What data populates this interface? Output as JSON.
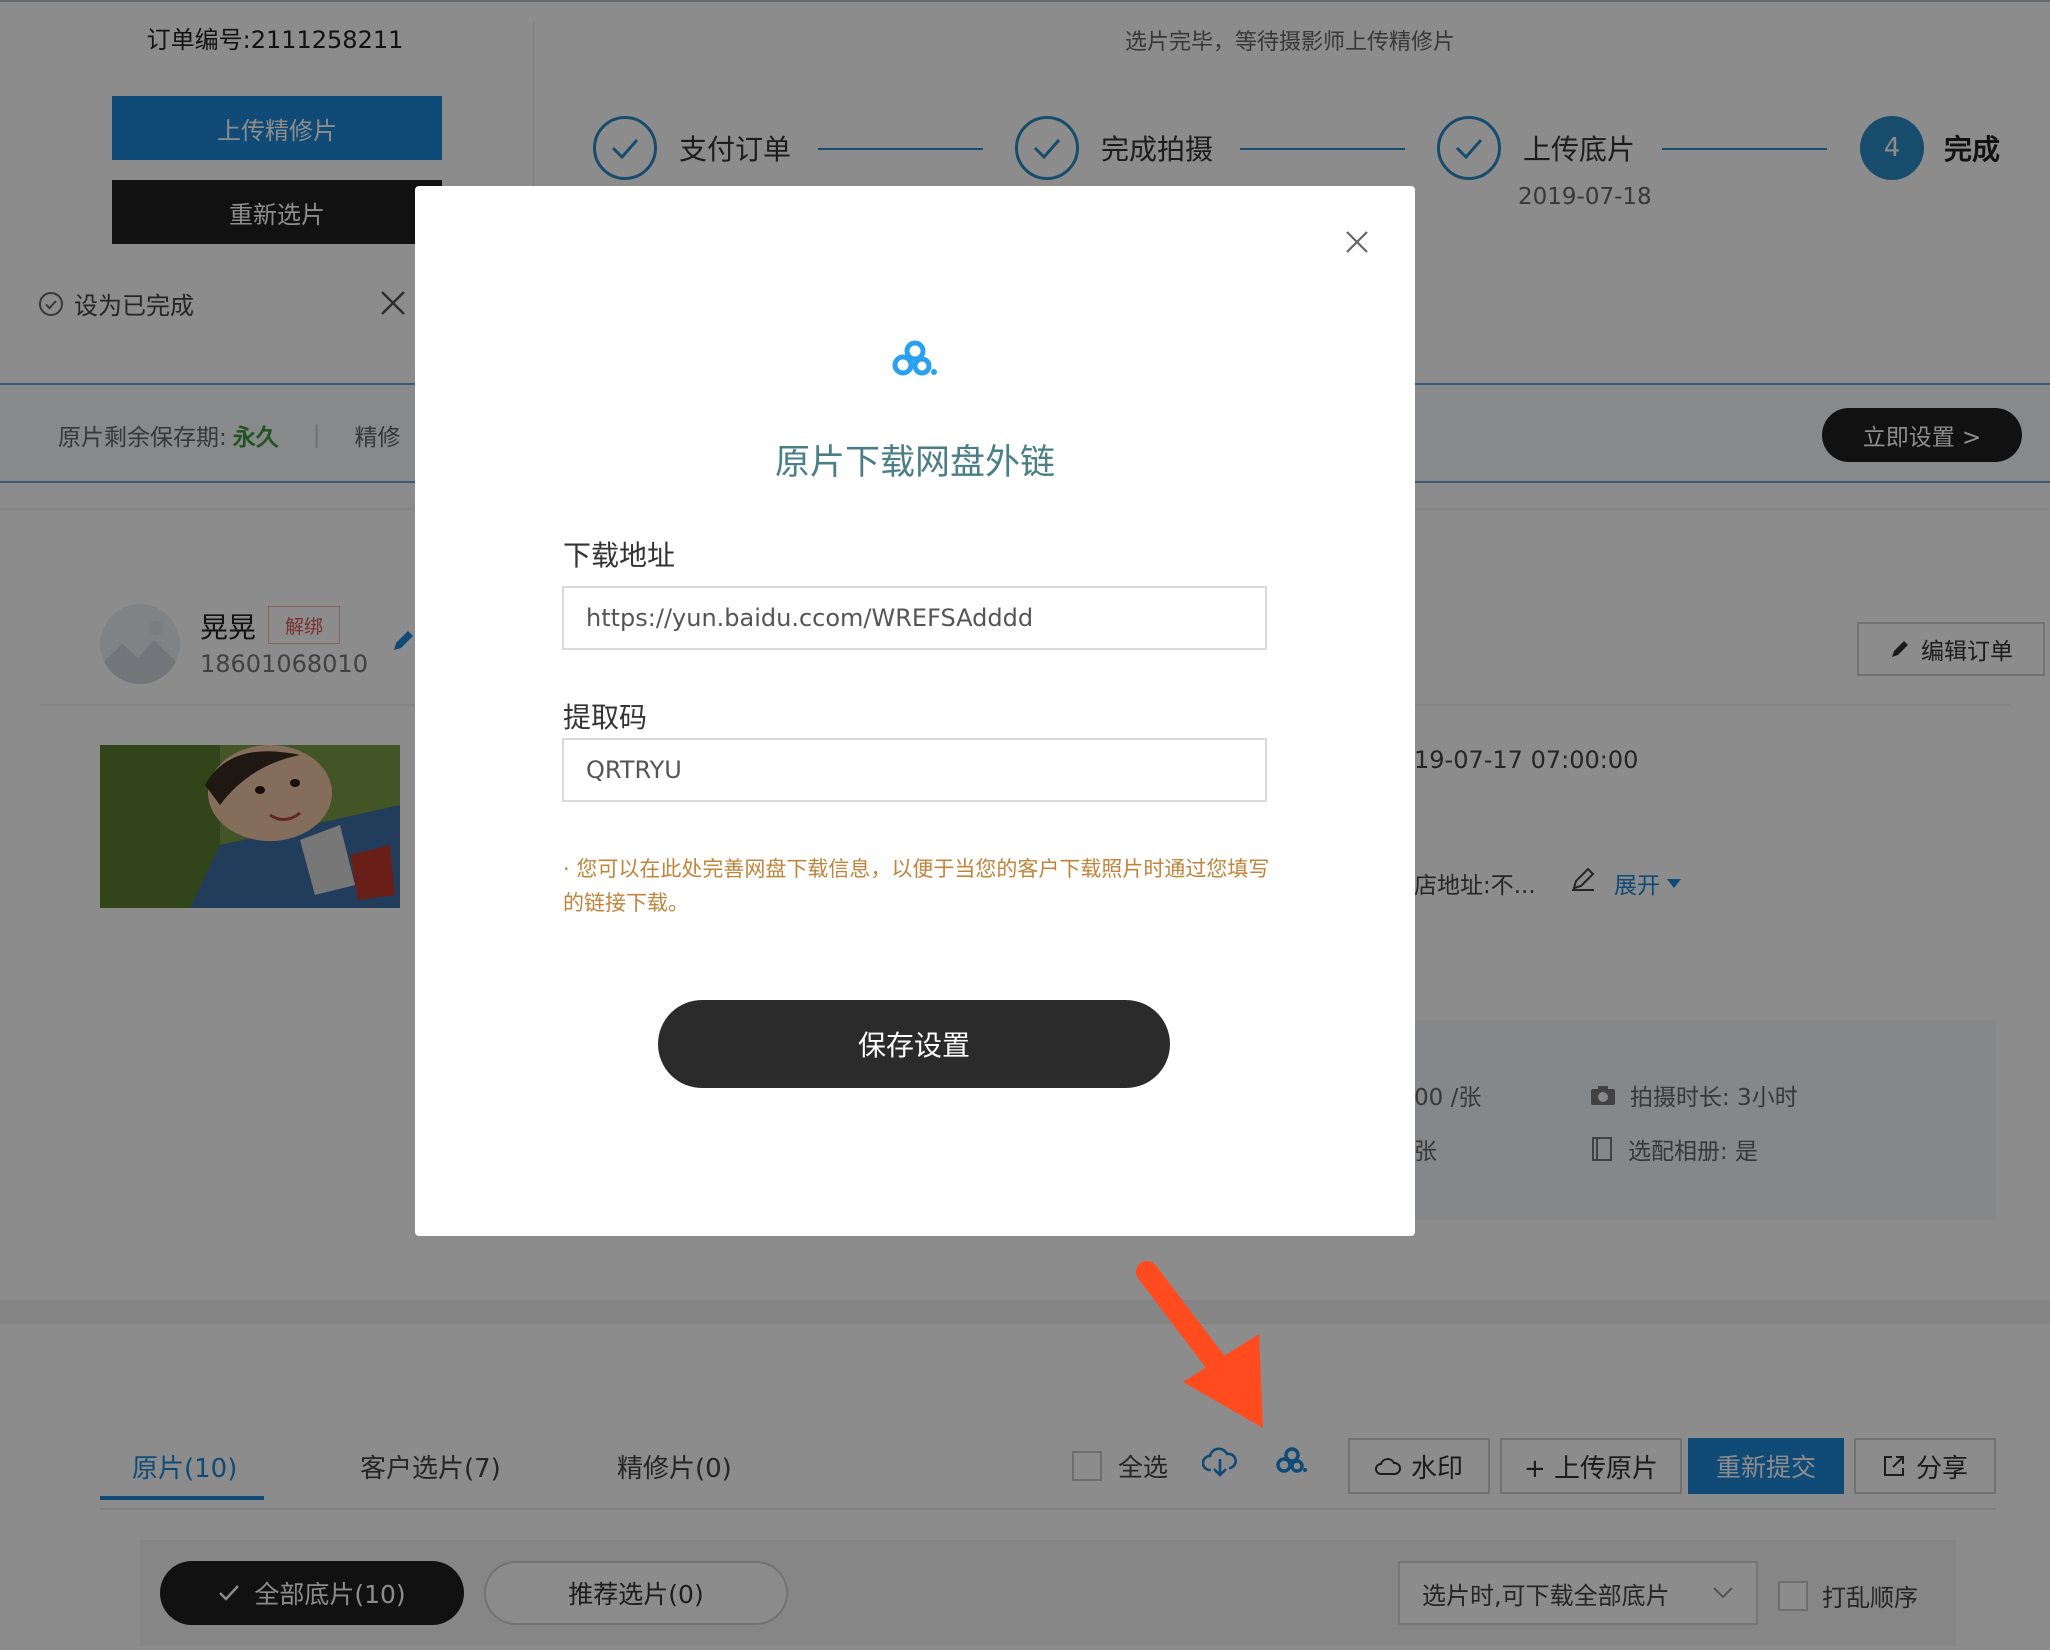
{
  "order": {
    "number_label": "订单编号:2111258211",
    "upload_refined_label": "上传精修片",
    "reselect_label": "重新选片",
    "mark_done_label": "设为已完成"
  },
  "progress": {
    "status_text": "选片完毕，等待摄影师上传精修片",
    "steps": [
      {
        "label": "支付订单",
        "date": "",
        "state": "done"
      },
      {
        "label": "完成拍摄",
        "date": "",
        "state": "done"
      },
      {
        "label": "上传底片",
        "date": "2019-07-18",
        "state": "done"
      },
      {
        "label": "完成",
        "number": "4",
        "state": "current"
      }
    ]
  },
  "notice": {
    "retention_label": "原片剩余保存期:",
    "retention_value": "永久",
    "separator": "|",
    "truncated_text": "精修",
    "set_now_label": "立即设置 >"
  },
  "customer": {
    "name": "晃晃",
    "unbind_label": "解绑",
    "phone": "18601068010",
    "edit_order_label": "编辑订单"
  },
  "order_detail": {
    "datetime_partial": "19-07-17 07:00:00",
    "address_partial": "店地址:不...",
    "expand_label": "展开",
    "price_partial": "00 /张",
    "count_partial": "张",
    "duration_label": "拍摄时长: 3小时",
    "album_label": "选配相册: 是"
  },
  "tabs": [
    {
      "label": "原片(10)",
      "active": true
    },
    {
      "label": "客户选片(7)",
      "active": false
    },
    {
      "label": "精修片(0)",
      "active": false
    }
  ],
  "toolbar": {
    "select_all_label": "全选",
    "watermark_label": "水印",
    "upload_original_label": "+ 上传原片",
    "resubmit_label": "重新提交",
    "share_label": "分享"
  },
  "filter": {
    "all_negatives_label": "全部底片(10)",
    "recommended_label": "推荐选片(0)",
    "download_option": "选片时,可下载全部底片",
    "shuffle_label": "打乱顺序"
  },
  "modal": {
    "title": "原片下载网盘外链",
    "download_url_label": "下载地址",
    "download_url_value": "https://yun.baidu.ccom/WREFSAdddd",
    "code_label": "提取码",
    "code_value": "QRTRYU",
    "hint": "· 您可以在此处完善网盘下载信息，以便于当您的客户下载照片时通过您填写的链接下载。",
    "save_label": "保存设置"
  },
  "colors": {
    "brand_blue": "#1e88d8",
    "step_blue": "#2d8ac6",
    "dark_button": "#1f1f1f",
    "retention_green": "#3d9a3d",
    "unbind_red": "#e05a5a",
    "hint_orange": "#c0843c",
    "annotation_arrow": "#ff4b1e",
    "modal_title": "#4a7f86"
  }
}
